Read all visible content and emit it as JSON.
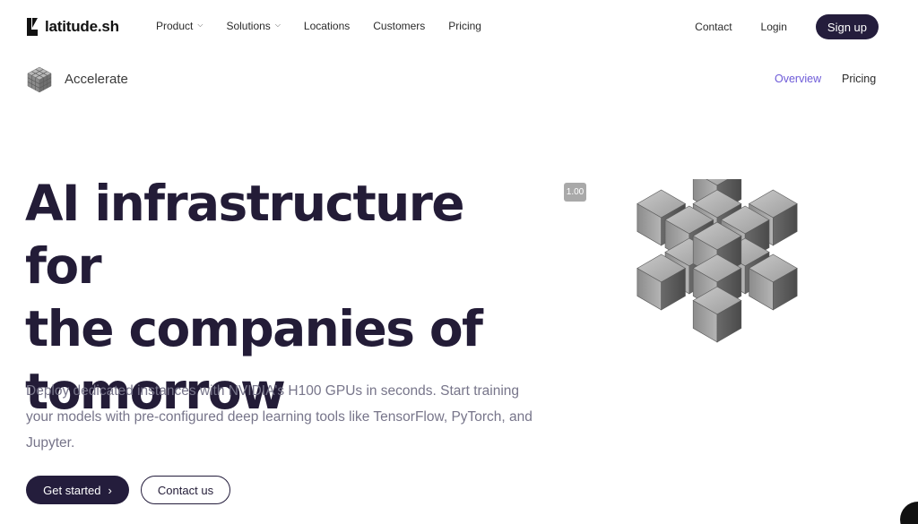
{
  "brand": {
    "name": "latitude.sh"
  },
  "nav": {
    "links": [
      {
        "label": "Product",
        "has_dropdown": true
      },
      {
        "label": "Solutions",
        "has_dropdown": true
      },
      {
        "label": "Locations",
        "has_dropdown": false
      },
      {
        "label": "Customers",
        "has_dropdown": false
      },
      {
        "label": "Pricing",
        "has_dropdown": false
      }
    ],
    "contact": "Contact",
    "login": "Login",
    "signup": "Sign up"
  },
  "subnav": {
    "product": "Accelerate",
    "tabs": [
      {
        "label": "Overview",
        "active": true
      },
      {
        "label": "Pricing",
        "active": false
      }
    ]
  },
  "hero": {
    "title": "AI infrastructure for\nthe companies of\ntomorrow",
    "description": "Deploy dedicated instances with NVIDIA's H100 GPUs in seconds. Start training your models with pre-configured deep learning tools like TensorFlow, PyTorch, and Jupyter.",
    "primary_button": "Get started",
    "secondary_button": "Contact us",
    "badge": "1.00"
  },
  "colors": {
    "brand_dark": "#241d3c",
    "accent_purple": "#6d5ad8",
    "text_muted": "#77758a"
  }
}
